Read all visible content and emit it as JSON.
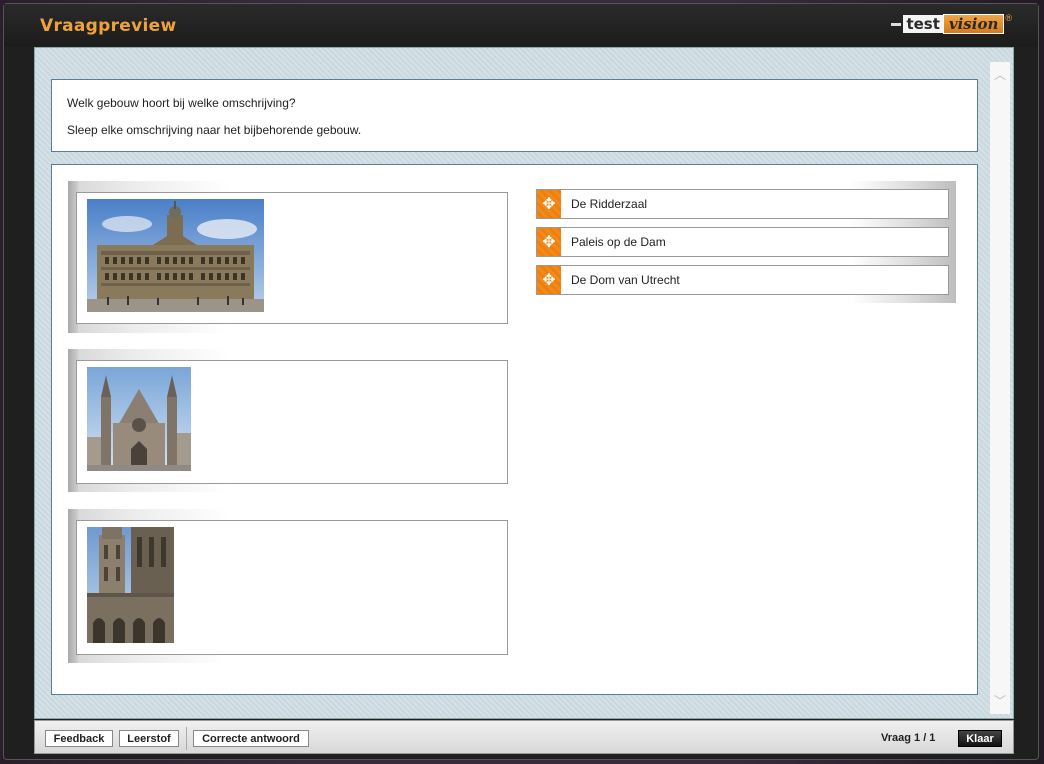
{
  "window": {
    "title": "Vraagpreview",
    "logo": {
      "part1": "test",
      "part2": "vision",
      "mark": "®"
    }
  },
  "question": {
    "prompt": "Welk gebouw hoort bij welke omschrijving?",
    "instruction": "Sleep elke omschrijving naar het bijbehorende gebouw."
  },
  "drop_targets": [
    {
      "image": "paleis-op-de-dam-photo"
    },
    {
      "image": "ridderzaal-photo"
    },
    {
      "image": "dom-van-utrecht-photo"
    }
  ],
  "drag_items": [
    {
      "label": "De Ridderzaal",
      "icon": "move-arrows-icon"
    },
    {
      "label": "Paleis op de Dam",
      "icon": "move-arrows-icon"
    },
    {
      "label": "De Dom van Utrecht",
      "icon": "move-arrows-icon"
    }
  ],
  "footer": {
    "feedback_label": "Feedback",
    "leerstof_label": "Leerstof",
    "correct_label": "Correcte antwoord",
    "counter": "Vraag 1 / 1",
    "klaar_label": "Klaar"
  },
  "colors": {
    "title": "#f0a23a",
    "handle": "#f28a1a",
    "border": "#5b7f92"
  }
}
